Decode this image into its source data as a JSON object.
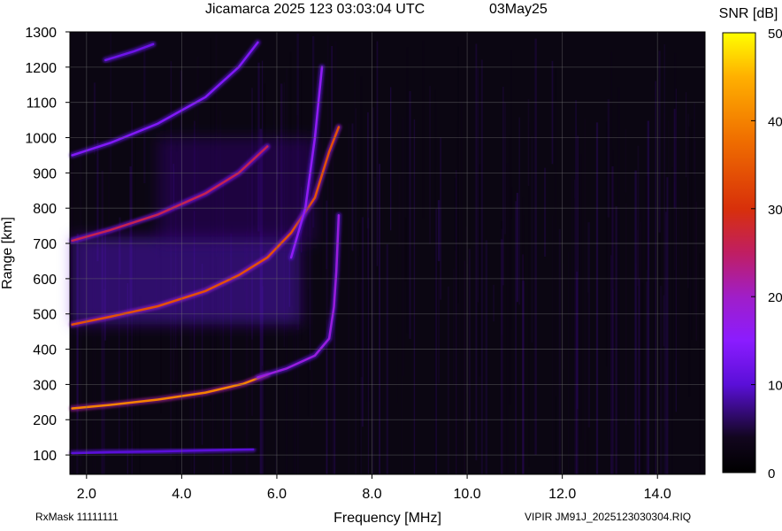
{
  "header": {
    "title": "Jicamarca 2025 123 03:03:04 UTC",
    "date": "03May25"
  },
  "footer": {
    "rxmask": "RxMask 11111111",
    "file": "VIPIR  JM91J_2025123030304.RIQ"
  },
  "colorbar": {
    "label": "SNR [dB]",
    "min": 0,
    "max": 50,
    "ticks": [
      "0",
      "10",
      "20",
      "30",
      "40",
      "50"
    ],
    "stops": [
      {
        "v": 0,
        "color": "#000000"
      },
      {
        "v": 4,
        "color": "#12061e"
      },
      {
        "v": 10,
        "color": "#5a0fd8"
      },
      {
        "v": 15,
        "color": "#8b1cff"
      },
      {
        "v": 20,
        "color": "#a01ec8"
      },
      {
        "v": 25,
        "color": "#c01e62"
      },
      {
        "v": 30,
        "color": "#d8300a"
      },
      {
        "v": 38,
        "color": "#f07000"
      },
      {
        "v": 45,
        "color": "#ffb000"
      },
      {
        "v": 50,
        "color": "#ffff00"
      }
    ]
  },
  "chart_data": {
    "type": "heatmap",
    "title": "Jicamarca 2025 123 03:03:04 UTC",
    "xlabel": "Frequency [MHz]",
    "ylabel": "Range [km]",
    "xlim": [
      1.65,
      15.0
    ],
    "ylim": [
      45,
      1300
    ],
    "xticks": [
      "2.0",
      "4.0",
      "6.0",
      "8.0",
      "10.0",
      "12.0",
      "14.0"
    ],
    "yticks": [
      "100",
      "200",
      "300",
      "400",
      "500",
      "600",
      "700",
      "800",
      "900",
      "1000",
      "1100",
      "1200",
      "1300"
    ],
    "grid": true,
    "traces": [
      {
        "name": "F-layer 1-hop O-mode",
        "snr": 40,
        "points": [
          [
            1.7,
            232
          ],
          [
            2.5,
            242
          ],
          [
            3.5,
            257
          ],
          [
            4.5,
            277
          ],
          [
            5.3,
            302
          ],
          [
            5.8,
            328
          ]
        ]
      },
      {
        "name": "F-layer 1-hop X-mode",
        "snr": 18,
        "points": [
          [
            5.6,
            320
          ],
          [
            6.2,
            345
          ],
          [
            6.8,
            382
          ],
          [
            7.1,
            430
          ],
          [
            7.2,
            520
          ],
          [
            7.25,
            620
          ],
          [
            7.3,
            780
          ]
        ]
      },
      {
        "name": "F-layer 2-hop",
        "snr": 34,
        "points": [
          [
            1.7,
            470
          ],
          [
            2.5,
            492
          ],
          [
            3.5,
            522
          ],
          [
            4.5,
            565
          ],
          [
            5.2,
            610
          ],
          [
            5.8,
            660
          ],
          [
            6.3,
            730
          ],
          [
            6.8,
            830
          ],
          [
            7.1,
            960
          ],
          [
            7.3,
            1030
          ]
        ]
      },
      {
        "name": "F-layer 3-hop",
        "snr": 26,
        "points": [
          [
            1.7,
            708
          ],
          [
            2.5,
            738
          ],
          [
            3.5,
            782
          ],
          [
            4.5,
            842
          ],
          [
            5.2,
            900
          ],
          [
            5.8,
            975
          ]
        ]
      },
      {
        "name": "F-layer 4-hop",
        "snr": 14,
        "points": [
          [
            1.7,
            950
          ],
          [
            2.5,
            985
          ],
          [
            3.5,
            1040
          ],
          [
            4.5,
            1115
          ],
          [
            5.2,
            1200
          ],
          [
            5.6,
            1270
          ]
        ]
      },
      {
        "name": "F-layer 5-hop",
        "snr": 12,
        "points": [
          [
            2.4,
            1220
          ],
          [
            3.0,
            1245
          ],
          [
            3.4,
            1265
          ]
        ]
      },
      {
        "name": "cusp 2-hop",
        "snr": 16,
        "points": [
          [
            6.3,
            660
          ],
          [
            6.6,
            800
          ],
          [
            6.8,
            1000
          ],
          [
            6.95,
            1200
          ]
        ]
      },
      {
        "name": "E-layer echo",
        "snr": 10,
        "points": [
          [
            1.7,
            105
          ],
          [
            2.5,
            108
          ],
          [
            3.5,
            110
          ],
          [
            4.5,
            113
          ],
          [
            5.5,
            116
          ]
        ]
      }
    ],
    "diffuse_regions": [
      {
        "name": "spread-F echo",
        "snr": 10,
        "x": [
          1.7,
          6.5
        ],
        "y": [
          470,
          720
        ]
      },
      {
        "name": "spread-F upper",
        "snr": 7,
        "x": [
          3.5,
          6.8
        ],
        "y": [
          700,
          1000
        ]
      }
    ],
    "noise_floor_snr": 3
  }
}
